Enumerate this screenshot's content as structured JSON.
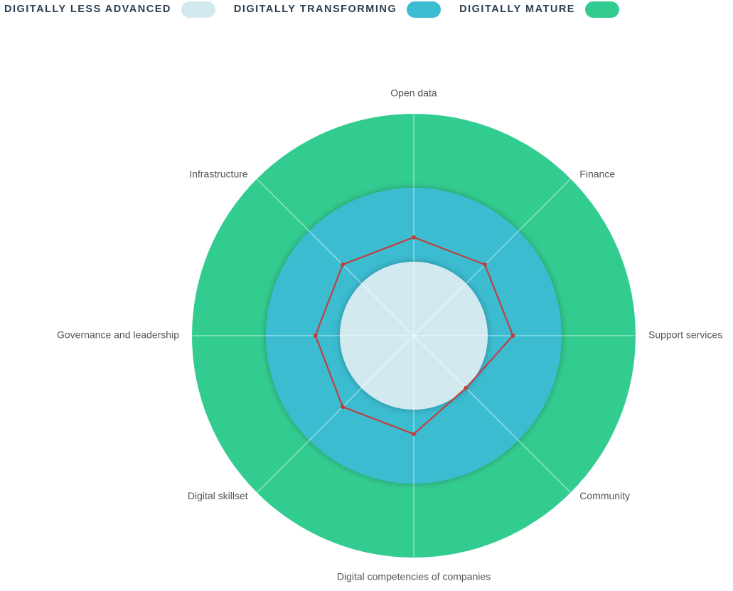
{
  "legend": {
    "items": [
      {
        "label": "DIGITALLY LESS ADVANCED",
        "color": "#d2eaef"
      },
      {
        "label": "DIGITALLY TRANSFORMING",
        "color": "#3bbcd1"
      },
      {
        "label": "DIGITALLY MATURE",
        "color": "#33cc90"
      }
    ]
  },
  "chart_data": {
    "type": "radar",
    "axes": [
      "Open data",
      "Finance",
      "Support services",
      "Community",
      "Digital competencies of companies",
      "Digital skillset",
      "Governance and leadership",
      "Infrastructure"
    ],
    "bands": [
      {
        "name": "DIGITALLY LESS ADVANCED",
        "from": 0,
        "to": 1,
        "color": "#d2eaef"
      },
      {
        "name": "DIGITALLY TRANSFORMING",
        "from": 1,
        "to": 2,
        "color": "#3bbcd1"
      },
      {
        "name": "DIGITALLY MATURE",
        "from": 2,
        "to": 3,
        "color": "#33cc90"
      }
    ],
    "series": [
      {
        "values": [
          1.33,
          1.36,
          1.34,
          1.0,
          1.33,
          1.36,
          1.33,
          1.36
        ],
        "color": "#c0403f"
      }
    ],
    "rlim": [
      0,
      3
    ],
    "grid": true,
    "legend_position": "top-left"
  }
}
